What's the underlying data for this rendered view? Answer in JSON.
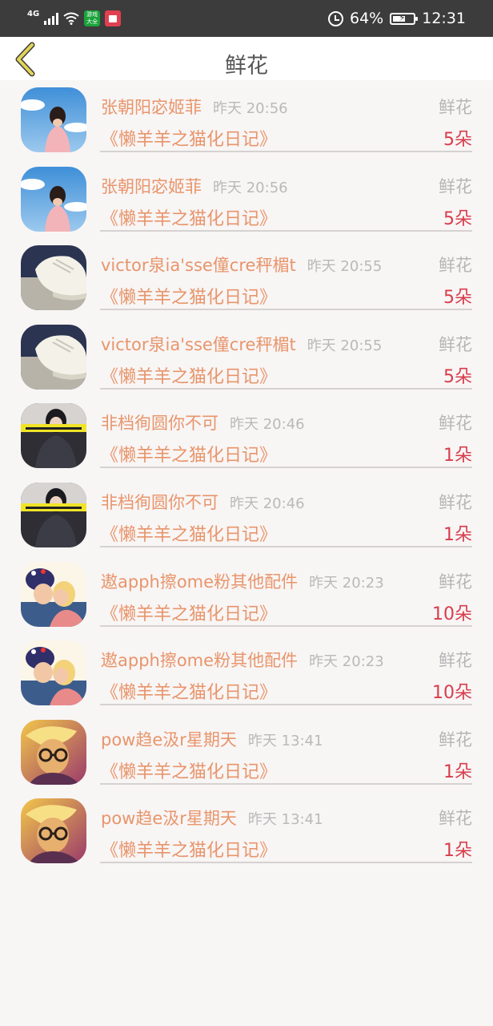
{
  "status_bar": {
    "network": "4G",
    "battery": "64%",
    "battery_level": 0.64,
    "time": "12:31",
    "icons": [
      "signal-icon",
      "wifi-icon",
      "game-app-icon",
      "book-app-icon",
      "alarm-icon",
      "battery-icon"
    ]
  },
  "header": {
    "title": "鲜花",
    "back_icon": "chevron-left-icon"
  },
  "colors": {
    "name": "#e8956b",
    "time": "#b9b9b9",
    "count": "#d83d4c",
    "back_icon": "#d9c84a"
  },
  "items": [
    {
      "name": "张朝阳宓姬菲",
      "time": "昨天 20:56",
      "type": "鲜花",
      "book": "《懒羊羊之猫化日记》",
      "count": "5朵",
      "avatar": "girl-sky"
    },
    {
      "name": "张朝阳宓姬菲",
      "time": "昨天 20:56",
      "type": "鲜花",
      "book": "《懒羊羊之猫化日记》",
      "count": "5朵",
      "avatar": "girl-sky"
    },
    {
      "name": "victor泉ia'sse僮cre秤楣t",
      "time": "昨天 20:55",
      "type": "鲜花",
      "book": "《懒羊羊之猫化日记》",
      "count": "5朵",
      "avatar": "sneaker"
    },
    {
      "name": "victor泉ia'sse僮cre秤楣t",
      "time": "昨天 20:55",
      "type": "鲜花",
      "book": "《懒羊羊之猫化日记》",
      "count": "5朵",
      "avatar": "sneaker"
    },
    {
      "name": "非档徇圆你不可",
      "time": "昨天 20:46",
      "type": "鲜花",
      "book": "《懒羊羊之猫化日记》",
      "count": "1朵",
      "avatar": "girl-dark"
    },
    {
      "name": "非档徇圆你不可",
      "time": "昨天 20:46",
      "type": "鲜花",
      "book": "《懒羊羊之猫化日记》",
      "count": "1朵",
      "avatar": "girl-dark"
    },
    {
      "name": "遨apph擦ome粉其他配件",
      "time": "昨天 20:23",
      "type": "鲜花",
      "book": "《懒羊羊之猫化日记》",
      "count": "10朵",
      "avatar": "kids-kiss"
    },
    {
      "name": "遨apph擦ome粉其他配件",
      "time": "昨天 20:23",
      "type": "鲜花",
      "book": "《懒羊羊之猫化日记》",
      "count": "10朵",
      "avatar": "kids-kiss"
    },
    {
      "name": "pow趋e汲r星期天",
      "time": "昨天 13:41",
      "type": "鲜花",
      "book": "《懒羊羊之猫化日记》",
      "count": "1朵",
      "avatar": "boy-glasses"
    },
    {
      "name": "pow趋e汲r星期天",
      "time": "昨天 13:41",
      "type": "鲜花",
      "book": "《懒羊羊之猫化日记》",
      "count": "1朵",
      "avatar": "boy-glasses"
    }
  ]
}
